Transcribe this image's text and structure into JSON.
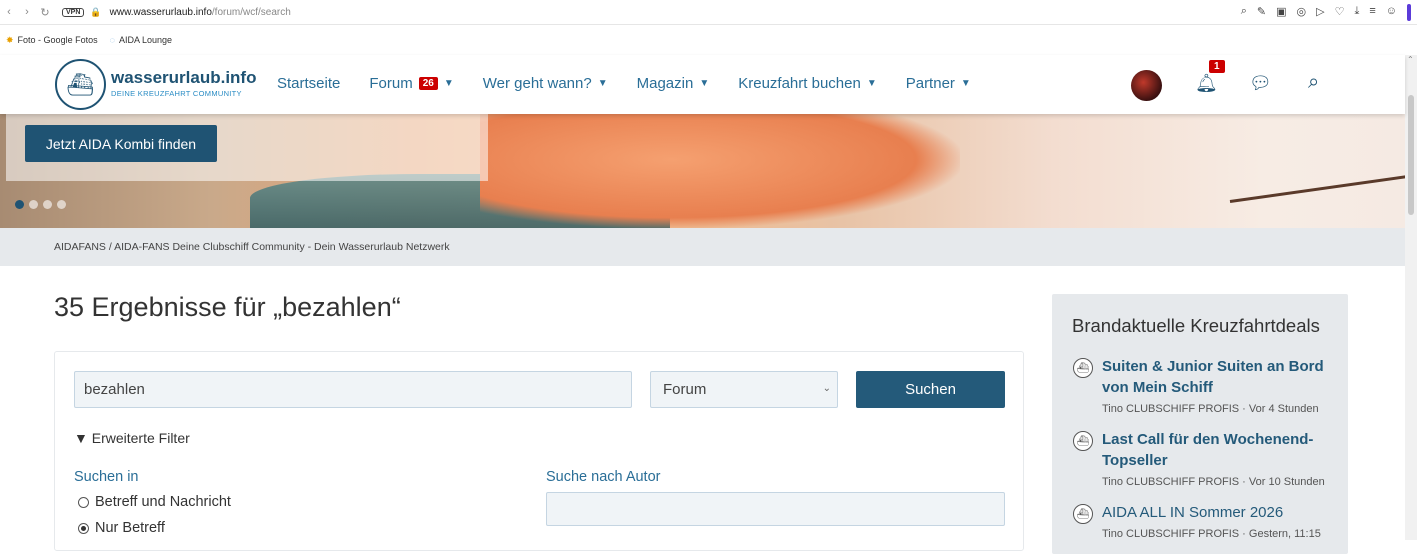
{
  "browser": {
    "vpn_label": "VPN",
    "url_host": "www.wasserurlaub.info",
    "url_path": "/forum/wcf/search",
    "bookmarks": [
      "Foto - Google Fotos",
      "AIDA Lounge"
    ]
  },
  "header": {
    "logo_title": "wasserurlaub.info",
    "logo_subtitle": "DEINE KREUZFAHRT COMMUNITY",
    "nav": [
      {
        "label": "Startseite"
      },
      {
        "label": "Forum",
        "badge": "26"
      },
      {
        "label": "Wer geht wann?"
      },
      {
        "label": "Magazin"
      },
      {
        "label": "Kreuzfahrt buchen"
      },
      {
        "label": "Partner"
      }
    ],
    "notifications_count": "1"
  },
  "hero": {
    "button_label": "Jetzt AIDA Kombi finden"
  },
  "breadcrumb": "AIDAFANS / AIDA-FANS Deine Clubschiff Community - Dein Wasserurlaub Netzwerk",
  "main": {
    "page_title": "35 Ergebnisse für „bezahlen“",
    "search_value": "bezahlen",
    "scope_value": "Forum",
    "search_button": "Suchen",
    "advanced_filters": "Erweiterte Filter",
    "search_in_label": "Suchen in",
    "search_in_options": [
      "Betreff und Nachricht",
      "Nur Betreff"
    ],
    "search_in_selected": 1,
    "author_label": "Suche nach Autor"
  },
  "sidebar": {
    "title": "Brandaktuelle Kreuzfahrtdeals",
    "deals": [
      {
        "title": "Suiten & Junior Suiten an Bord von Mein Schiff",
        "meta": "Tino CLUBSCHIFF PROFIS · Vor 4 Stunden"
      },
      {
        "title": "Last Call für den Wochenend-Topseller",
        "meta": "Tino CLUBSCHIFF PROFIS · Vor 10 Stunden"
      },
      {
        "title": "AIDA ALL IN Sommer 2026",
        "meta": "Tino CLUBSCHIFF PROFIS · Gestern, 11:15"
      }
    ]
  }
}
